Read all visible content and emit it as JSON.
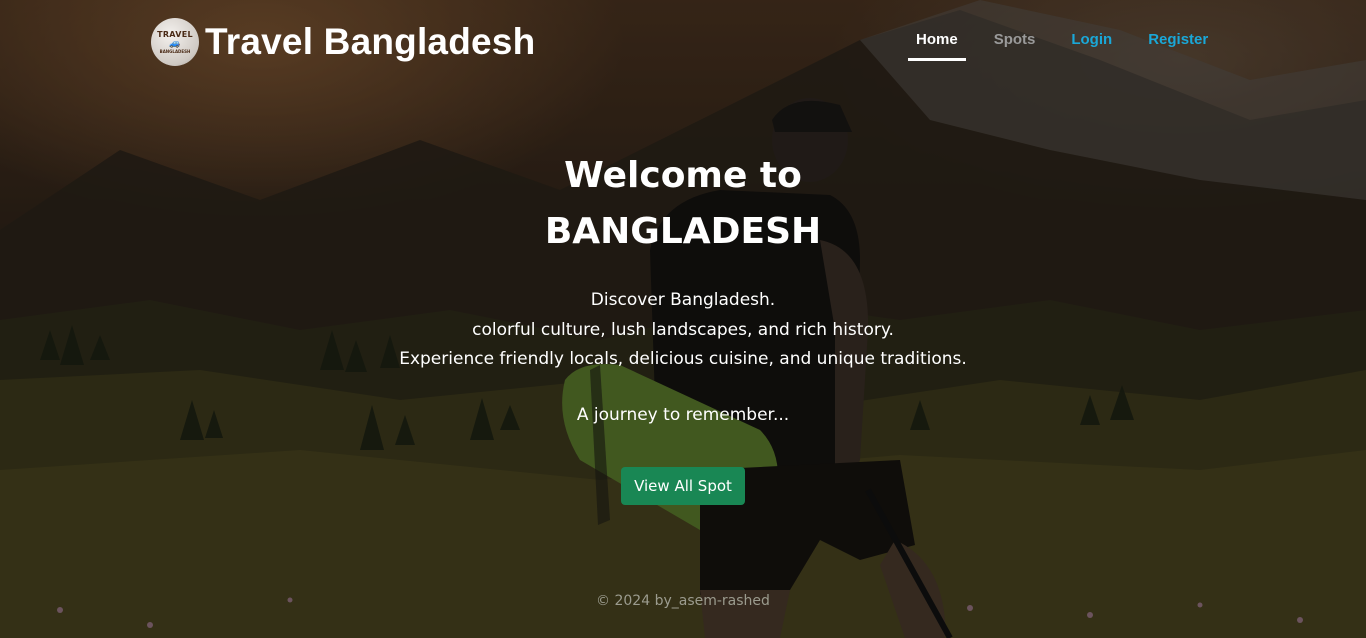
{
  "brand": {
    "logo_line1": "TRAVEL",
    "logo_line2": "BANGLADESH",
    "name": "Travel Bangladesh"
  },
  "nav": {
    "home": "Home",
    "spots": "Spots",
    "login": "Login",
    "register": "Register",
    "active": "Home"
  },
  "hero": {
    "title_line1": "Welcome to",
    "title_line2": "BANGLADESH",
    "desc_line1": "Discover Bangladesh.",
    "desc_line2": "colorful culture, lush landscapes, and rich history.",
    "desc_line3": "Experience friendly locals, delicious cuisine, and unique traditions.",
    "tagline": "A journey to remember...",
    "cta_label": "View All Spot"
  },
  "footer": {
    "text": "© 2024 by_asem-rashed"
  },
  "colors": {
    "cta": "#198754",
    "nav_auth": "#1aa8d8",
    "nav_inactive": "#9a9a9a"
  }
}
